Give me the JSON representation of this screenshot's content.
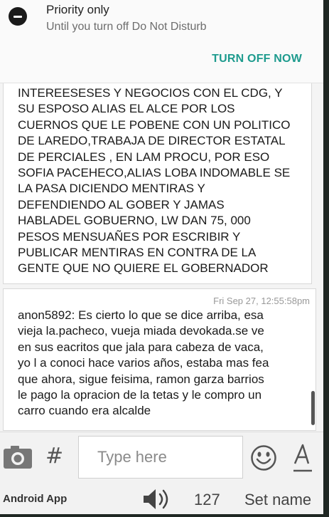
{
  "notification": {
    "title": "Priority only",
    "subtitle": "Until you turn off Do Not Disturb",
    "action": "TURN OFF NOW",
    "icon": "do-not-disturb-icon"
  },
  "messages": [
    {
      "text": "INTEREESESES Y NEGOCIOS CON EL CDG, Y\nSU ESPOSO ALIAS EL ALCE POR LOS\nCUERNOS QUE LE POBENE CON UN POLITICO\nDE LAREDO,TRABAJA DE DIRECTOR ESTATAL\nDE PERCIALES , EN LAM PROCU, POR ESO\nSOFIA PACEHECO,ALIAS LOBA INDOMABLE SE\nLA PASA DICIENDO MENTIRAS Y\nDEFENDIENDO AL GOBER Y JAMAS\nHABLADEL GOBUERNO, LW DAN 75, 000\nPESOS MENSUAÑES POR ESCRIBIR Y\nPUBLICAR MENTIRAS EN CONTRA DE LA\nGENTE QUE NO QUIERE EL GOBERNADOR"
    },
    {
      "timestamp": "Fri Sep 27, 12:55:58pm",
      "text": "anon5892: Es cierto lo que se dice arriba, esa\nvieja la.pacheco, vueja miada devokada.se ve\nen sus eacritos que jala para cabeza de vaca,\nyo l a conoci hace varios años, estaba mas fea\nque ahora, sigue feisima, ramon garza barrios\nle pago la opracion de la tetas y le compro un\ncarro cuando era alcalde"
    }
  ],
  "input": {
    "placeholder": "Type here",
    "camera_icon": "camera-icon",
    "hash_label": "#",
    "emoji_icon": "smiley-icon",
    "font_icon": "font-format-icon"
  },
  "status": {
    "app_label": "Android App",
    "speaker_icon": "speaker-icon",
    "count": "127",
    "set_name": "Set name"
  },
  "colors": {
    "accent": "#1e9b8e",
    "frame": "#1f2723"
  }
}
